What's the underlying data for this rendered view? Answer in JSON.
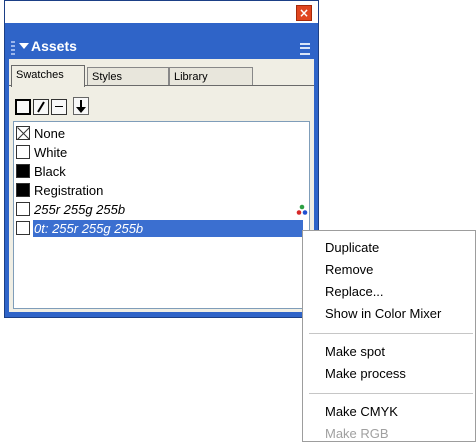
{
  "panel": {
    "title": "Assets",
    "tabs": [
      "Swatches",
      "Styles",
      "Library"
    ],
    "active_tab": "Swatches"
  },
  "swatches": [
    {
      "label": "None",
      "swatch": "none"
    },
    {
      "label": "White",
      "swatch": "white"
    },
    {
      "label": "Black",
      "swatch": "black"
    },
    {
      "label": "Registration",
      "swatch": "black"
    },
    {
      "label": "255r 255g 255b",
      "swatch": "white",
      "style": "italic"
    },
    {
      "label": "0t: 255r 255g 255b",
      "swatch": "white",
      "style": "italic",
      "selected": true
    }
  ],
  "context_menu": {
    "items": [
      {
        "label": "Duplicate",
        "enabled": true
      },
      {
        "label": "Remove",
        "enabled": true
      },
      {
        "label": "Replace...",
        "enabled": true
      },
      {
        "label": "Show in Color Mixer",
        "enabled": true
      },
      {
        "label": "Make spot",
        "enabled": true
      },
      {
        "label": "Make process",
        "enabled": true
      },
      {
        "label": "Make CMYK",
        "enabled": true
      },
      {
        "label": "Make RGB",
        "enabled": false
      }
    ]
  },
  "colors": {
    "panel_blue": "#2f64c8",
    "selection_blue": "#3b6fd0",
    "close_red": "#e0461f"
  }
}
